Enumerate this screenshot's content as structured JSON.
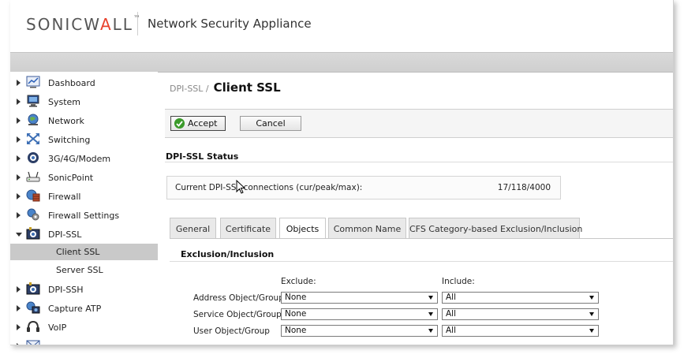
{
  "header": {
    "logo_sonic": "SONIC",
    "logo_wall": "WALL",
    "logo_tm": "™",
    "app_title": "Network Security Appliance"
  },
  "sidebar": {
    "items": [
      {
        "label": "Dashboard",
        "icon": "dashboard-icon"
      },
      {
        "label": "System",
        "icon": "system-monitor-icon"
      },
      {
        "label": "Network",
        "icon": "network-globe-icon"
      },
      {
        "label": "Switching",
        "icon": "switching-icon"
      },
      {
        "label": "3G/4G/Modem",
        "icon": "modem-icon"
      },
      {
        "label": "SonicPoint",
        "icon": "sonicpoint-icon"
      },
      {
        "label": "Firewall",
        "icon": "firewall-icon"
      },
      {
        "label": "Firewall Settings",
        "icon": "firewall-settings-icon"
      },
      {
        "label": "DPI-SSL",
        "icon": "dpi-ssl-icon"
      },
      {
        "label": "DPI-SSH",
        "icon": "dpi-ssh-icon"
      },
      {
        "label": "Capture ATP",
        "icon": "capture-atp-icon"
      },
      {
        "label": "VoIP",
        "icon": "voip-headset-icon"
      }
    ],
    "sub_items": [
      {
        "label": "Client SSL",
        "active": true
      },
      {
        "label": "Server SSL",
        "active": false
      }
    ]
  },
  "breadcrumb": {
    "parent": "DPI-SSL /",
    "current": "Client SSL"
  },
  "toolbar": {
    "accept_label": "Accept",
    "cancel_label": "Cancel"
  },
  "status": {
    "title": "DPI-SSL Status",
    "label": "Current DPI-SSL connections (cur/peak/max):",
    "value": "17/118/4000"
  },
  "tabs": [
    {
      "label": "General",
      "active": false
    },
    {
      "label": "Certificate",
      "active": false
    },
    {
      "label": "Objects",
      "active": true
    },
    {
      "label": "Common Name",
      "active": false
    },
    {
      "label": "CFS Category-based Exclusion/Inclusion",
      "active": false
    }
  ],
  "exclusion": {
    "title": "Exclusion/Inclusion",
    "exclude_header": "Exclude:",
    "include_header": "Include:",
    "rows": [
      {
        "label": "Address Object/Group",
        "exclude": "None",
        "include": "All"
      },
      {
        "label": "Service Object/Group",
        "exclude": "None",
        "include": "All"
      },
      {
        "label": "User Object/Group",
        "exclude": "None",
        "include": "All"
      }
    ]
  },
  "colors": {
    "accent_red": "#e8412c",
    "active_nav_bg": "#c9c9c9",
    "accept_check_green": "#3a9a2a"
  }
}
